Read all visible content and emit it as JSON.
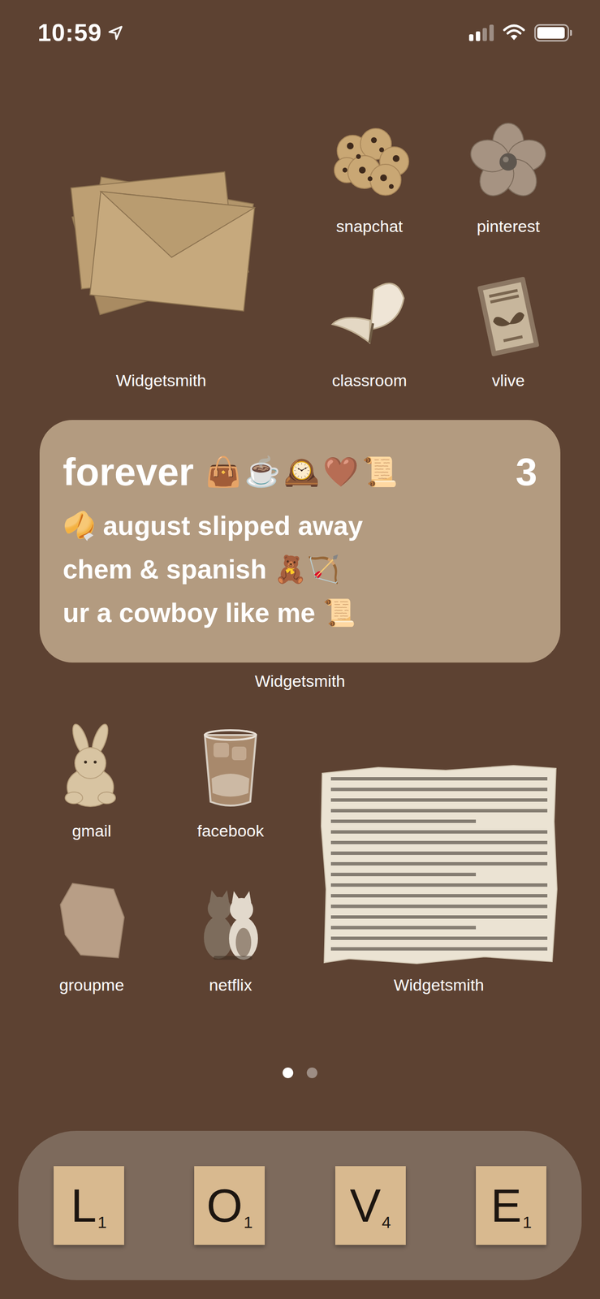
{
  "status_bar": {
    "time": "10:59",
    "signal": {
      "level": 0.5
    },
    "battery": {
      "level": 0.95
    }
  },
  "home": {
    "top_widget": {
      "label": "Widgetsmith"
    },
    "top_apps": [
      {
        "label": "snapchat"
      },
      {
        "label": "pinterest"
      },
      {
        "label": "classroom"
      },
      {
        "label": "vlive"
      }
    ],
    "text_widget": {
      "title": "forever",
      "title_emoji": "👜☕🕰️🤎📜",
      "count": "3",
      "lines": [
        "🥠 august slipped away",
        "chem & spanish 🧸🏹",
        "ur a cowboy like me 📜"
      ],
      "label": "Widgetsmith"
    },
    "bottom_apps": [
      {
        "label": "gmail"
      },
      {
        "label": "facebook"
      },
      {
        "label": "groupme"
      },
      {
        "label": "netflix"
      }
    ],
    "bottom_widget": {
      "label": "Widgetsmith"
    }
  },
  "page_dots": [
    {
      "selected": true
    },
    {
      "selected": false
    }
  ],
  "dock": [
    {
      "letter": "L",
      "points": "1"
    },
    {
      "letter": "O",
      "points": "1"
    },
    {
      "letter": "V",
      "points": "4"
    },
    {
      "letter": "E",
      "points": "1"
    }
  ]
}
